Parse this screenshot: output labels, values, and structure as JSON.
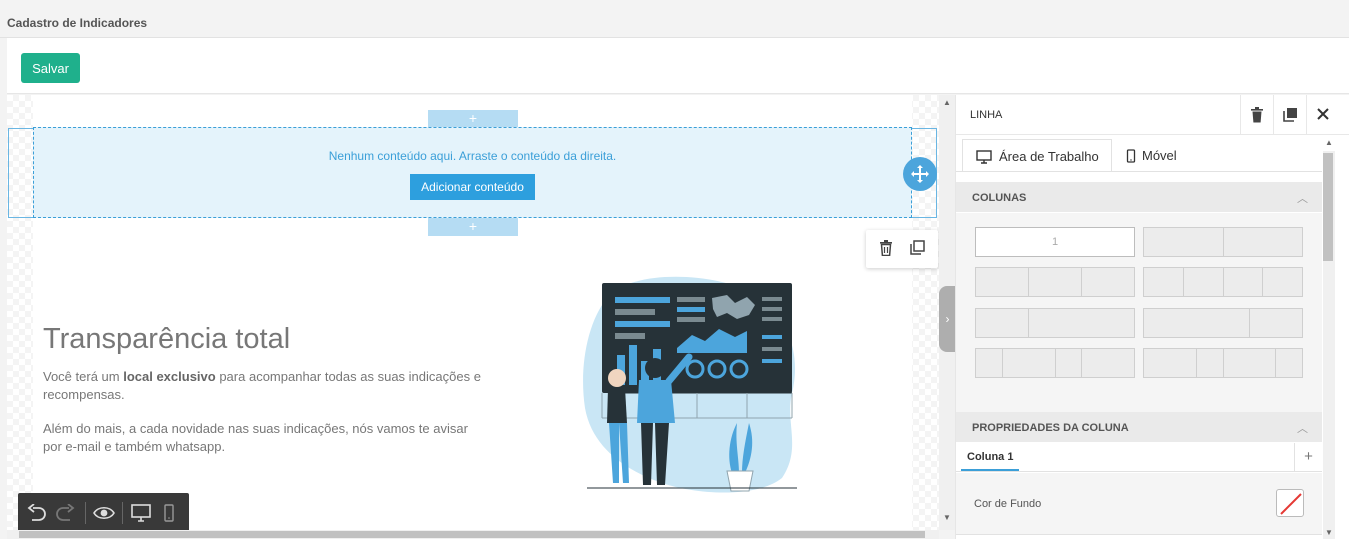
{
  "header": {
    "title": "Cadastro de Indicadores"
  },
  "toolbar": {
    "save_label": "Salvar"
  },
  "editor": {
    "add_row_symbol": "+",
    "empty_row": {
      "message": "Nenhum conteúdo aqui. Arraste o conteúdo da direita.",
      "add_button_label": "Adicionar conteúdo"
    },
    "hero": {
      "title": "Transparência total",
      "paragraph1_before": "Você terá um ",
      "paragraph1_bold": "local exclusivo",
      "paragraph1_after": " para acompanhar todas as  suas indicações e recompensas.",
      "paragraph2": "Além do mais, a cada novidade nas suas indicações, nós vamos te avisar por e-mail e também whatsapp."
    }
  },
  "panel": {
    "title": "LINHA",
    "tabs": [
      {
        "label": "Área de Trabalho",
        "icon": "desktop-icon"
      },
      {
        "label": "Móvel",
        "icon": "mobile-icon"
      }
    ],
    "columns_section": {
      "title": "COLUNAS",
      "selected_label": "1"
    },
    "column_props_section": {
      "title": "PROPRIEDADES DA COLUNA",
      "column_tab": "Coluna 1",
      "add_symbol": "+"
    },
    "background_color": {
      "label": "Cor de Fundo"
    }
  },
  "colors": {
    "accent": "#1fb08c",
    "primary_blue": "#2d9fde",
    "row_bg": "#e4f3fb",
    "illustration_blue": "#4ca5dc"
  }
}
